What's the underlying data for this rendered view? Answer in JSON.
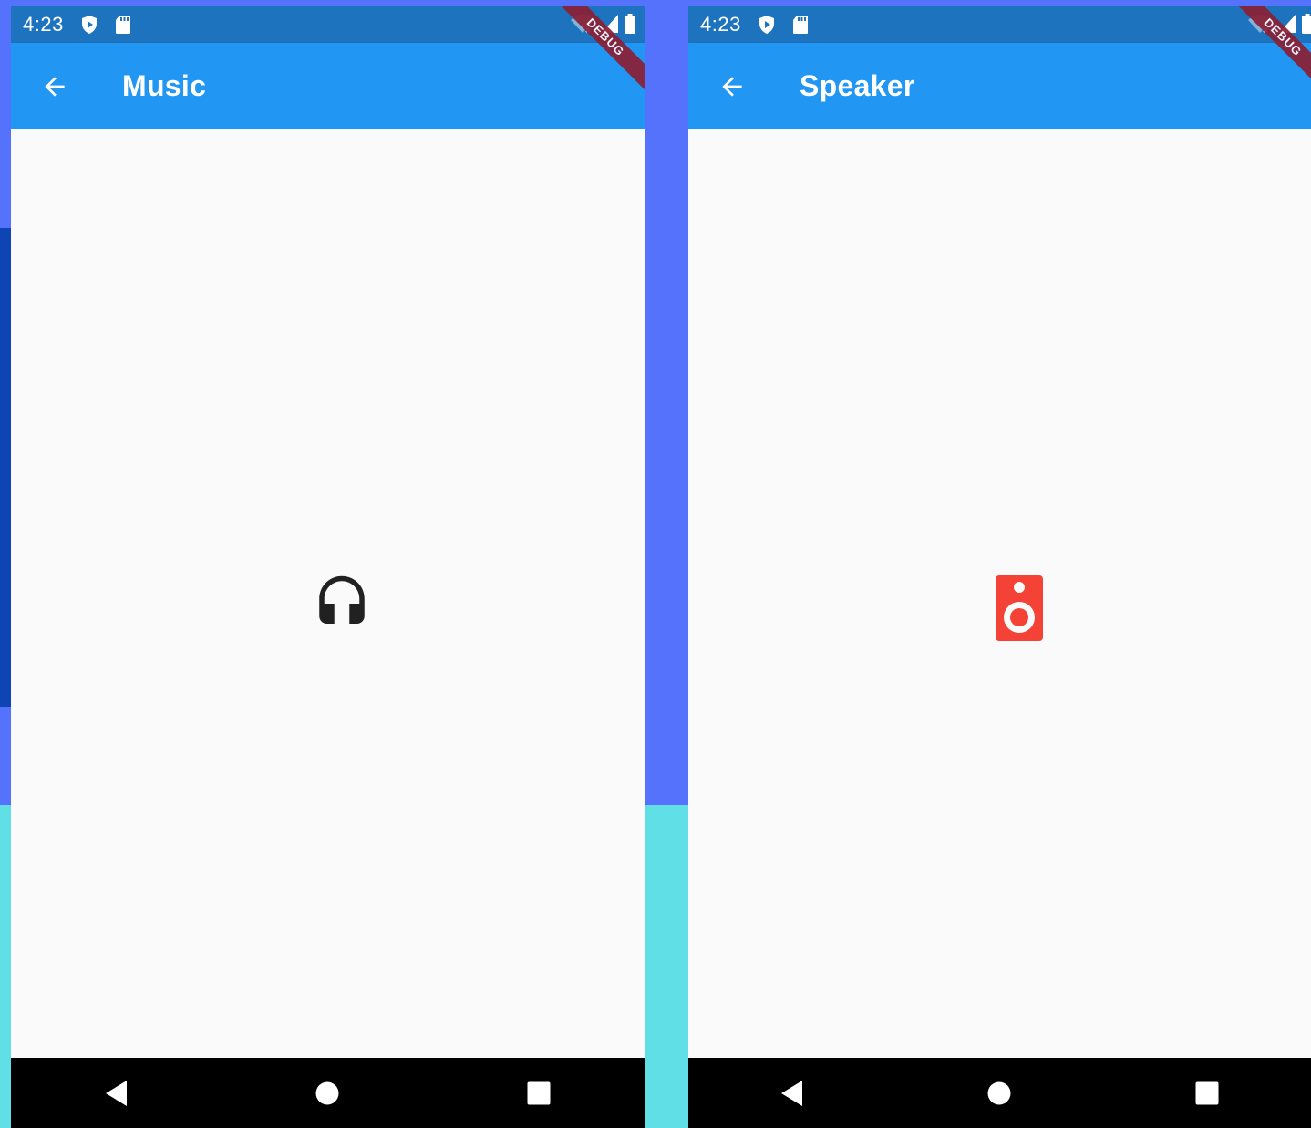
{
  "screens": [
    {
      "status_time": "4:23",
      "debug_label": "DEBUG",
      "title": "Music",
      "back_icon": "arrow-back-icon",
      "center_icon": "headset-icon",
      "center_icon_color": "#212121"
    },
    {
      "status_time": "4:23",
      "debug_label": "DEBUG",
      "title": "Speaker",
      "back_icon": "arrow-back-icon",
      "center_icon": "speaker-icon",
      "center_icon_color": "#f44336"
    }
  ],
  "colors": {
    "app_bar": "#2196f3",
    "status_bar": "#1e73be",
    "background_top": "#5472fb",
    "background_bottom": "#60e0e6",
    "nav_bar": "#000000"
  },
  "nav_icons": [
    "back-triangle-icon",
    "home-circle-icon",
    "recents-square-icon"
  ]
}
